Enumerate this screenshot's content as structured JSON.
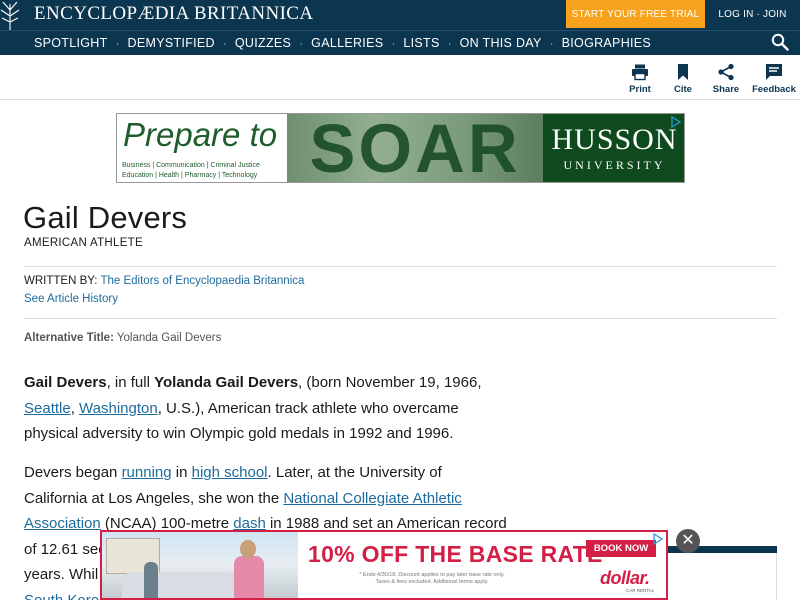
{
  "header": {
    "brand": "ENCYCLOPÆDIA BRITANNICA",
    "trial_button": "START YOUR FREE TRIAL",
    "login_link": "LOG IN · JOIN",
    "colors": {
      "navy": "#0c3550",
      "orange": "#f7a21c",
      "link": "#1d6b9c"
    }
  },
  "nav": {
    "items": [
      "SPOTLIGHT",
      "DEMYSTIFIED",
      "QUIZZES",
      "GALLERIES",
      "LISTS",
      "ON THIS DAY",
      "BIOGRAPHIES"
    ],
    "separator": "·",
    "search_icon": "search-icon"
  },
  "tools": [
    {
      "label": "Print",
      "icon": "print-icon"
    },
    {
      "label": "Cite",
      "icon": "bookmark-icon"
    },
    {
      "label": "Share",
      "icon": "share-icon"
    },
    {
      "label": "Feedback",
      "icon": "feedback-icon"
    }
  ],
  "ad_top": {
    "headline": "Prepare to",
    "big_word": "SOAR",
    "sub_line1": "Business | Communication | Criminal Justice",
    "sub_line2": "Education | Health | Pharmacy | Technology",
    "brand": "HUSSON",
    "brand_sub": "UNIVERSITY"
  },
  "article": {
    "title": "Gail Devers",
    "subtitle": "AMERICAN ATHLETE",
    "written_label": "WRITTEN BY:",
    "written_by": "The Editors of Encyclopaedia Britannica",
    "history_link": "See Article History",
    "alt_label": "Alternative Title:",
    "alt_value": "Yolanda Gail Devers",
    "p1": {
      "name": "Gail Devers",
      "t1": ", in full ",
      "fullname": "Yolanda Gail Devers",
      "t2": ", (born November 19, 1966,",
      "link_seattle": "Seattle",
      "t3": ", ",
      "link_washington": "Washington",
      "t4": ", U.S.), American track athlete who overcame",
      "t5": "physical adversity to win Olympic gold medals in 1992 and 1996."
    },
    "p2": {
      "t1": "Devers began ",
      "link_running": "running",
      "t2": " in ",
      "link_highschool": "high school",
      "t3": ". Later, at the University of",
      "t4": "California at Los Angeles, she won the ",
      "link_ncaa1": "National Collegiate Athletic",
      "link_ncaa2": "Association",
      "t5": " (NCAA) 100-metre ",
      "link_dash": "dash",
      "t6": " in 1988 and set an American record",
      "t7": "of 12.61 sec",
      "t8": "years. Whil",
      "link_korea": "South Kore"
    }
  },
  "ad_bottom": {
    "offer": "10% OFF THE BASE RATE",
    "offer_mark": "*",
    "fine1": "* Ends 4/30/18. Discount applies to pay later base rate only.",
    "fine2": "Taxes & fees excluded. Additional terms apply.",
    "cta": "BOOK NOW",
    "brand": "dollar.",
    "brand_sub": "CAR RENTAL",
    "close": "✕"
  }
}
